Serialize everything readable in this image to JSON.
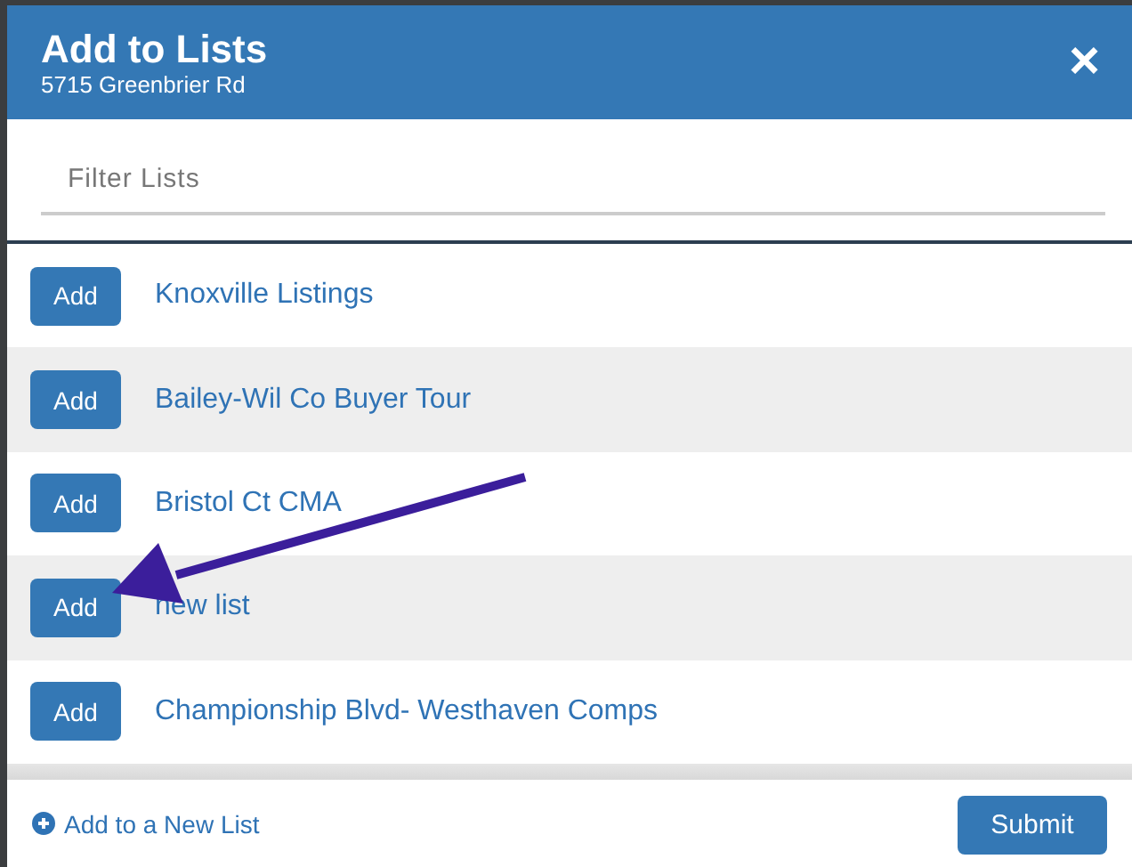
{
  "dialog": {
    "title": "Add to Lists",
    "subtitle": "5715 Greenbrier Rd",
    "close": "×"
  },
  "filter": {
    "placeholder": "Filter Lists"
  },
  "lists": [
    {
      "button": "Add",
      "name": "Knoxville Listings"
    },
    {
      "button": "Add",
      "name": "Bailey-Wil Co Buyer Tour"
    },
    {
      "button": "Add",
      "name": "Bristol Ct CMA"
    },
    {
      "button": "Add",
      "name": "new list"
    },
    {
      "button": "Add",
      "name": "Championship Blvd- Westhaven Comps"
    }
  ],
  "footer": {
    "new_list_link": "Add to a New List",
    "submit": "Submit"
  }
}
